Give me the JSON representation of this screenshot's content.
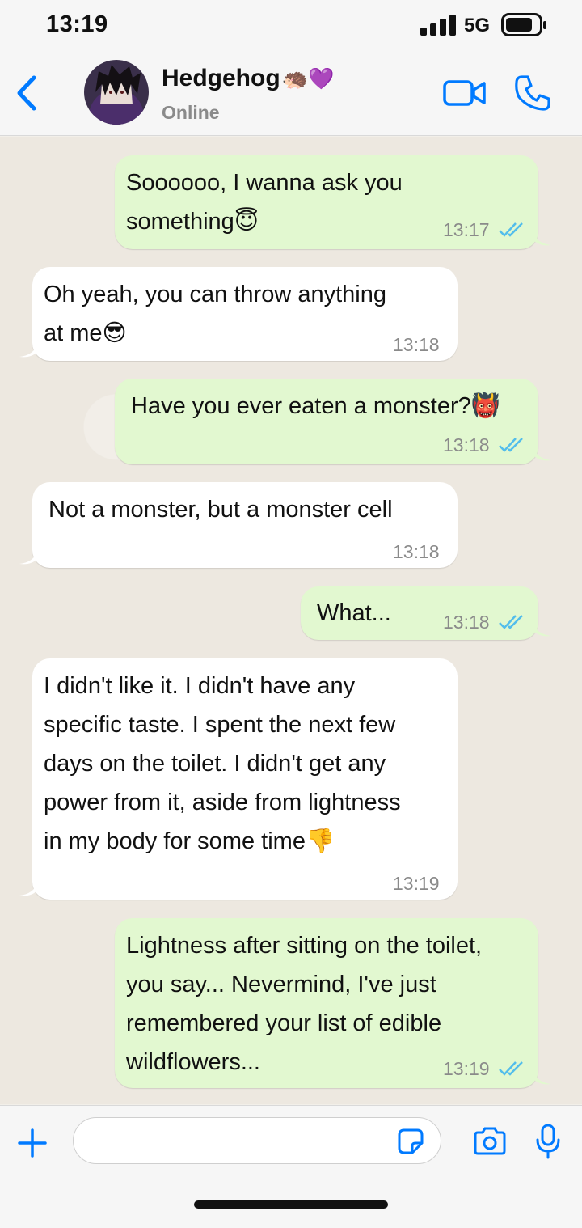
{
  "status_bar": {
    "time": "13:19",
    "network": "5G"
  },
  "header": {
    "contact_name": "Hedgehog",
    "name_emoji": "🦔💜",
    "status": "Online"
  },
  "messages": [
    {
      "direction": "outgoing",
      "text": "Soooooo, I wanna ask you\nsomething😇",
      "time": "13:17",
      "read": true
    },
    {
      "direction": "incoming",
      "text": "Oh yeah, you can throw anything\nat me😎",
      "time": "13:18"
    },
    {
      "direction": "outgoing",
      "text": "Have you ever eaten a monster?👹",
      "time": "13:18",
      "read": true
    },
    {
      "direction": "incoming",
      "text": "Not a monster, but a monster cell",
      "time": "13:18"
    },
    {
      "direction": "outgoing",
      "text": "What...",
      "time": "13:18",
      "read": true
    },
    {
      "direction": "incoming",
      "text": "I didn't like it. I didn't have any\nspecific taste. I spent the next few\ndays on the toilet. I didn't get any\npower from it, aside from lightness\nin my body for some time👎",
      "time": "13:19"
    },
    {
      "direction": "outgoing",
      "text": "Lightness after sitting on the toilet,\nyou say... Nevermind, I've just\nremembered your list of edible\nwildflowers...",
      "time": "13:19",
      "read": true
    }
  ],
  "input": {
    "placeholder": ""
  },
  "colors": {
    "accent": "#007aff",
    "outgoing_bubble": "#e2f8d0",
    "incoming_bubble": "#ffffff",
    "read_ticks": "#53bdeb"
  },
  "icons": {
    "back": "chevron-left-icon",
    "video": "video-camera-icon",
    "phone": "phone-icon",
    "plus": "plus-icon",
    "sticker": "sticker-icon",
    "camera": "camera-icon",
    "mic": "microphone-icon"
  }
}
